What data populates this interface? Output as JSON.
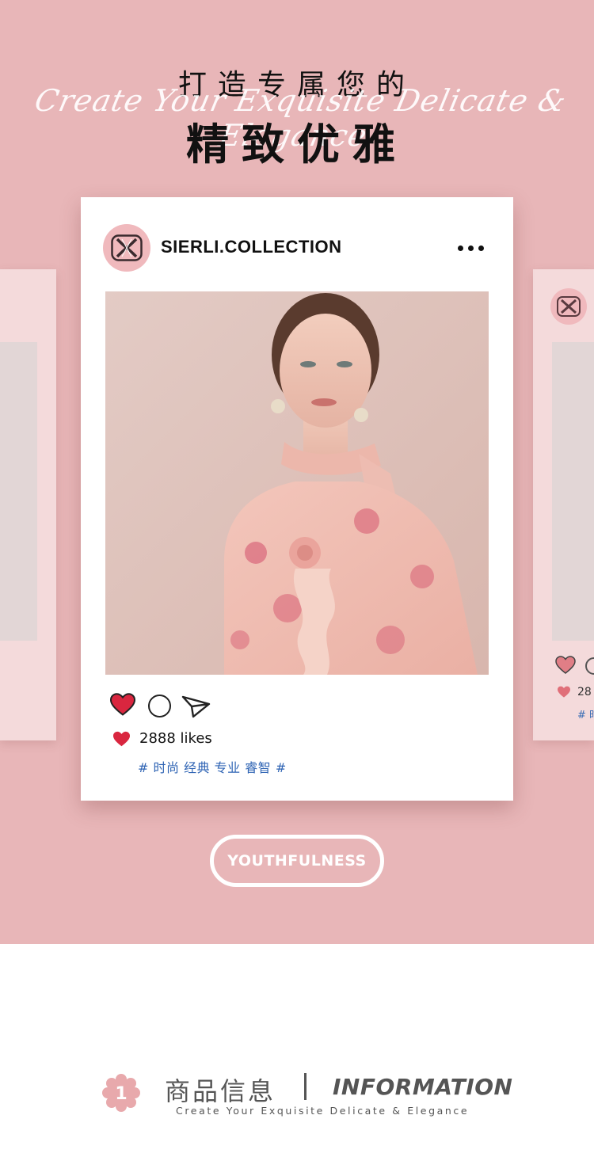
{
  "header": {
    "title_top": "打造专属您的",
    "script_line": "Create Your Exquisite Delicate & Elegance",
    "title_main": "精致优雅"
  },
  "post": {
    "account_name": "SIERLI.COLLECTION",
    "likes": "2888 likes",
    "tags": "# 时尚 经典 专业 睿智 #",
    "photo_icon": "model-photo"
  },
  "side_card": {
    "likes_partial": "28",
    "tags_partial": "# 时"
  },
  "pill_label": "YOUTHFULNESS",
  "info": {
    "badge_number": "1",
    "title_cn": "商品信息",
    "title_en": "INFORMATION",
    "subtitle": "Create Your Exquisite Delicate & Elegance"
  },
  "colors": {
    "hero_bg": "#e8b6b8",
    "heart": "#d9263f",
    "tag_blue": "#2f64b4",
    "badge_pink": "#e8a9ac"
  }
}
